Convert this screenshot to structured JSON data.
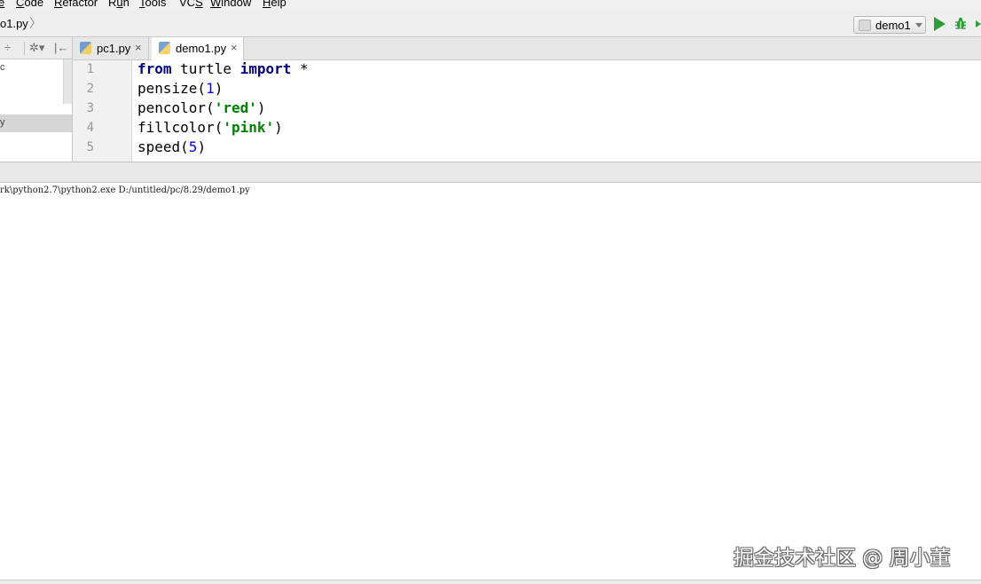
{
  "menu": [
    {
      "pre": "",
      "mnemonic": "e",
      "post": ""
    },
    {
      "pre": "",
      "mnemonic": "C",
      "post": "ode"
    },
    {
      "pre": "",
      "mnemonic": "R",
      "post": "efactor"
    },
    {
      "pre": "R",
      "mnemonic": "u",
      "post": "n"
    },
    {
      "pre": "",
      "mnemonic": "T",
      "post": "ools"
    },
    {
      "pre": "VC",
      "mnemonic": "S",
      "post": ""
    },
    {
      "pre": "",
      "mnemonic": "W",
      "post": "indow"
    },
    {
      "pre": "",
      "mnemonic": "H",
      "post": "elp"
    }
  ],
  "navbar": {
    "breadcrumb": "o1.py",
    "chevron": "〉",
    "run_config": "demo1"
  },
  "left_panel": {
    "toolbar": {
      "collapse": "÷",
      "settings": "✲▾",
      "hide": "|←"
    },
    "fragments": [
      "c",
      "y"
    ]
  },
  "tabs": [
    {
      "label": "pc1.py",
      "close": "×",
      "active": false
    },
    {
      "label": "demo1.py",
      "close": "×",
      "active": true
    }
  ],
  "editor": {
    "line_numbers": [
      "1",
      "2",
      "3",
      "4",
      "5"
    ],
    "lines": [
      [
        {
          "t": "from",
          "c": "kw"
        },
        {
          "t": " turtle ",
          "c": ""
        },
        {
          "t": "import",
          "c": "kw"
        },
        {
          "t": " *",
          "c": ""
        }
      ],
      [
        {
          "t": "pensize(",
          "c": ""
        },
        {
          "t": "1",
          "c": "num"
        },
        {
          "t": ")",
          "c": ""
        }
      ],
      [
        {
          "t": "pencolor(",
          "c": ""
        },
        {
          "t": "'red'",
          "c": "str"
        },
        {
          "t": ")",
          "c": ""
        }
      ],
      [
        {
          "t": "fillcolor(",
          "c": ""
        },
        {
          "t": "'pink'",
          "c": "str"
        },
        {
          "t": ")",
          "c": ""
        }
      ],
      [
        {
          "t": "speed(",
          "c": ""
        },
        {
          "t": "5",
          "c": "num"
        },
        {
          "t": ")",
          "c": ""
        }
      ]
    ]
  },
  "console": {
    "output": "rk\\python2.7\\python2.exe D:/untitled/pc/8.29/demo1.py"
  },
  "watermark": "掘金技术社区 @ 周小董",
  "colors": {
    "run_green": "#2e9e3a",
    "keyword": "#000080",
    "string": "#008000",
    "number": "#0000ff"
  }
}
